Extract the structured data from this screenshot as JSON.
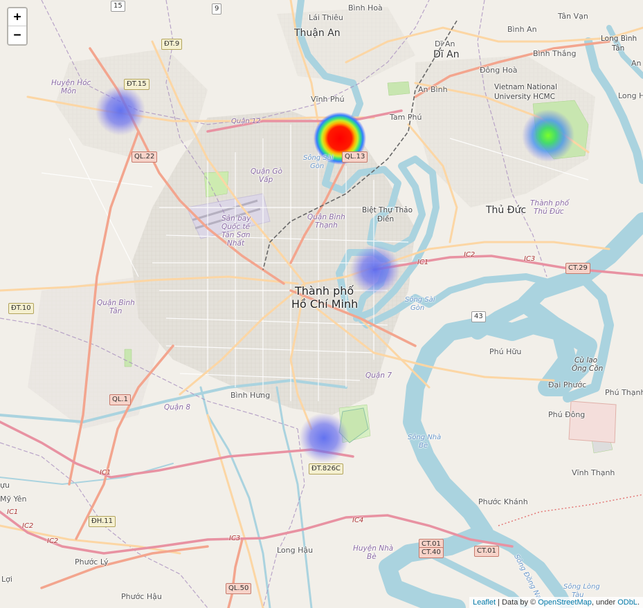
{
  "zoom": {
    "in_label": "+",
    "out_label": "−"
  },
  "attribution": {
    "leaflet": "Leaflet",
    "sep1": " | Data by © ",
    "osm": "OpenStreetMap",
    "sep2": ", under ",
    "odbl": "ODbL",
    "end": "."
  },
  "labels": {
    "lai_thieu": "Lái Thiêu",
    "binh_hoa": "Bình Hoà",
    "thuan_an": "Thuận An",
    "di_an_small": "Dĩ An",
    "di_an": "Dĩ An",
    "binh_an": "Bình An",
    "tan_van": "Tân Vạn",
    "long_binh_tan_1": "Long Bình",
    "long_binh_tan_2": "Tân",
    "an": "An",
    "binh_thang": "Bình Thắng",
    "dong_hoa": "Đông Hoà",
    "vnu_1": "Vietnam National",
    "vnu_2": "University HCMC",
    "an_binh": "An Bình",
    "long_hu": "Long Hư",
    "vinh_phu": "Vĩnh Phú",
    "tam_phu": "Tam Phú",
    "huyen_hoc_mon_1": "Huyện Hóc",
    "huyen_hoc_mon_2": "Môn",
    "quan_12": "Quận 12",
    "song_sai_gon_1a": "Sông Sài",
    "song_sai_gon_1b": "Gòn",
    "quan_go_vap_1": "Quận Gò",
    "quan_go_vap_2": "Vấp",
    "san_bay_1": "Sân bay",
    "san_bay_2": "Quốc tế",
    "san_bay_3": "Tân Sơn",
    "san_bay_4": "Nhất",
    "quan_binh_thanh_1": "Quận Bình",
    "quan_binh_thanh_2": "Thạnh",
    "biet_thu_1": "Biệt Thự Thảo",
    "biet_thu_2": "Điền",
    "thu_duc": "Thủ Đức",
    "tp_thu_duc_1": "Thành phố",
    "tp_thu_duc_2": "Thủ Đức",
    "hcm_1": "Thành phố",
    "hcm_2": "Hồ Chí Minh",
    "quan_binh_tan_1": "Quận Bình",
    "quan_binh_tan_2": "Tân",
    "song_sai_gon_2a": "Sông Sài",
    "song_sai_gon_2b": "Gòn",
    "phu_huu": "Phú Hữu",
    "cu_lao_1": "Cù lao",
    "cu_lao_2": "Ông Cồn",
    "dai_phuoc": "Đại Phước",
    "phu_thanh": "Phú Thạnh",
    "phu_dong": "Phú Đông",
    "quan_7": "Quận 7",
    "binh_hung": "Bình Hưng",
    "quan_8": "Quận 8",
    "song_nha_be_1": "Sông Nhà",
    "song_nha_be_2": "Bè",
    "vinh_thanh": "Vĩnh Thạnh",
    "phuoc_khanh": "Phước Khánh",
    "my_yen": "Mỹ Yên",
    "u": "ựu",
    "long_hau": "Long Hậu",
    "huyen_nha_be_1": "Huyện Nhà",
    "huyen_nha_be_2": "Bè",
    "phuoc_ly": "Phước Lý",
    "loi": "Lợi",
    "phuoc_hau": "Phước Hậu",
    "song_dong_nai": "Sông Đồng Nai",
    "song_long_tau_1": "Sông Lòng",
    "song_long_tau_2": "Tàu"
  },
  "shields": {
    "s15": "15",
    "s9": "9",
    "dt9": "ĐT.9",
    "dt15": "ĐT.15",
    "ql22": "QL.22",
    "ql13": "QL.13",
    "dt10": "ĐT.10",
    "ql1": "QL.1",
    "ct29": "CT.29",
    "s43": "43",
    "dt826c": "ĐT.826C",
    "dh11": "ĐH.11",
    "ct01a": "CT.01",
    "ct40": "CT.40",
    "ct01b": "CT.01",
    "ql50": "QL.50"
  },
  "highways": {
    "ic1a": "IC1",
    "ic2a": "IC2",
    "ic3a": "IC3",
    "ic1b": "IC1",
    "ic1c": "IC1",
    "ic2b": "IC2",
    "ic2c": "IC2",
    "ic3b": "IC3",
    "ic4": "IC4"
  },
  "heat_points": [
    {
      "name": "hoc-mon",
      "intensity": 0.35
    },
    {
      "name": "vinh-phu",
      "intensity": 1.0
    },
    {
      "name": "vnu-hcmc",
      "intensity": 0.6
    },
    {
      "name": "binh-thanh",
      "intensity": 0.3
    },
    {
      "name": "quan-7-south",
      "intensity": 0.3
    }
  ],
  "colors": {
    "water": "#aad3df",
    "land": "#f2efe9",
    "motorway": "#e892a2",
    "trunk": "#f9b29c",
    "primary": "#fcd6a4",
    "district": "#a58bbd"
  }
}
